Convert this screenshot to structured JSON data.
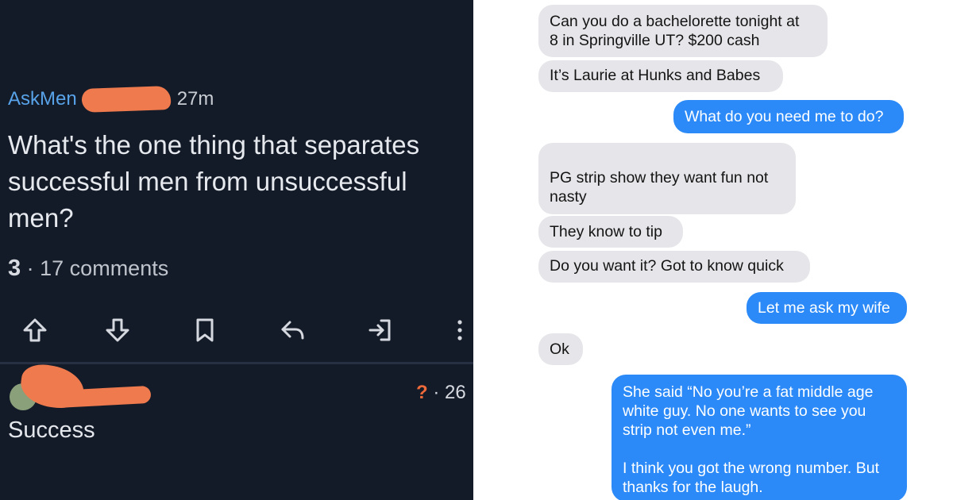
{
  "reddit": {
    "subreddit": "AskMen",
    "time": "27m",
    "post_title": "What's the one thing that separates successful men from unsuccessful men?",
    "score": "3",
    "comments": "· 17 comments",
    "actions": [
      "upvote-icon",
      "downvote-icon",
      "bookmark-icon",
      "reply-icon",
      "share-icon",
      "more-vertical-icon"
    ],
    "comment": {
      "vote_symbol": "?",
      "time": "· 26",
      "body": "Success"
    }
  },
  "messages": [
    {
      "dir": "in",
      "text": "Can you do a bachelorette tonight at\n8 in Springville UT? $200 cash"
    },
    {
      "dir": "in",
      "text": "It’s Laurie at Hunks and Babes"
    },
    {
      "dir": "out",
      "text": "What do you need me to do?"
    },
    {
      "dir": "in",
      "text": "PG strip show they want fun not\nnasty"
    },
    {
      "dir": "in",
      "text": "They know to tip"
    },
    {
      "dir": "in",
      "text": "Do you want it? Got to know quick"
    },
    {
      "dir": "out",
      "text": "Let me ask my wife"
    },
    {
      "dir": "in",
      "text": "Ok"
    },
    {
      "dir": "out",
      "text": "She said “No you’re a fat middle age\nwhite guy. No one wants to see you\nstrip not even me.”\n\nI think you got the wrong number. But\nthanks for the laugh."
    }
  ],
  "colors": {
    "reddit_bg": "#141b28",
    "subreddit_link": "#57a2e8",
    "redaction": "#ef7a4e",
    "imessage_blue": "#2b8af7",
    "imessage_gray": "#e6e6ea"
  }
}
